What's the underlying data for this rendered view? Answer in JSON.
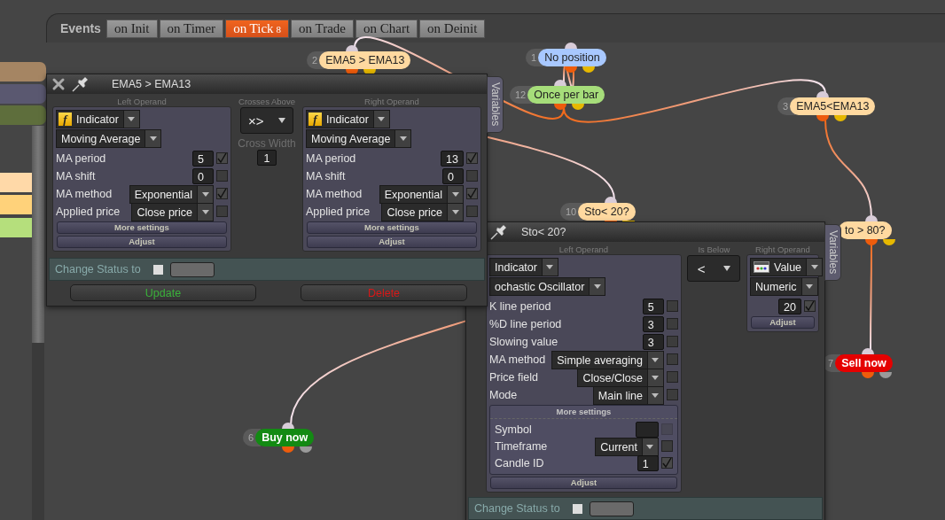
{
  "event_bar": {
    "label": "Events",
    "tabs": [
      {
        "label": "on Init",
        "selected": false
      },
      {
        "label": "on Timer",
        "selected": false
      },
      {
        "label": "on Tick",
        "badge": "8",
        "selected": true
      },
      {
        "label": "on Trade",
        "selected": false
      },
      {
        "label": "on Chart",
        "selected": false
      },
      {
        "label": "on Deinit",
        "selected": false
      }
    ]
  },
  "sidebar": {
    "items": [
      {
        "color": "#a58563"
      },
      {
        "color": "#5a5870"
      },
      {
        "color": "#5e6e3c"
      },
      {
        "color": "#ffd9a8"
      },
      {
        "color": "#ffd27a"
      },
      {
        "color": "#b5df7c"
      }
    ]
  },
  "nodes": [
    {
      "number": "2",
      "label": "EMA5 > EMA13",
      "kind": "condition",
      "color": "#ffd9a0"
    },
    {
      "number": "1",
      "label": "No position",
      "kind": "condition",
      "color": "#a8c8ff"
    },
    {
      "number": "12",
      "label": "Once per bar",
      "kind": "condition",
      "color": "#a6dd7a"
    },
    {
      "number": "3",
      "label": "EMA5<EMA13",
      "kind": "condition",
      "color": "#ffd9a0"
    },
    {
      "number": "10",
      "label": "Sto< 20?",
      "kind": "condition",
      "color": "#ffd9a0"
    },
    {
      "label": "to > 80?",
      "kind": "condition",
      "color": "#ffd9a0"
    },
    {
      "number": "7",
      "label": "Sell now",
      "kind": "action",
      "color": "#e50000"
    },
    {
      "number": "6",
      "label": "Buy now",
      "kind": "action",
      "color": "#138a13"
    }
  ],
  "windows": [
    {
      "title": "EMA5 > EMA13",
      "close_button": true,
      "variables_tab": "Variables",
      "left_header": "Left Operand",
      "operator_header": "Crosses Above",
      "right_header": "Right Operand",
      "left_operand": {
        "source": "Indicator",
        "kind": "indicator",
        "source_icon": "f",
        "function": "Moving Average",
        "params": [
          {
            "label": "MA period",
            "kind": "number",
            "value": "5",
            "checked": true
          },
          {
            "label": "MA shift",
            "kind": "number",
            "value": "0",
            "checked": false
          },
          {
            "label": "MA method",
            "kind": "select",
            "value": "Exponential",
            "checked": true
          },
          {
            "label": "Applied price",
            "kind": "select",
            "value": "Close price",
            "checked": false
          }
        ],
        "more_settings": {
          "label": "More settings",
          "expanded": false
        },
        "adjust": "Adjust"
      },
      "operator": {
        "symbol": "×>",
        "extra_label": "Cross Width",
        "extra_value": "1"
      },
      "right_operand": {
        "source": "Indicator",
        "kind": "indicator",
        "source_icon": "f",
        "function": "Moving Average",
        "params": [
          {
            "label": "MA period",
            "kind": "number",
            "value": "13",
            "checked": true
          },
          {
            "label": "MA shift",
            "kind": "number",
            "value": "0",
            "checked": false
          },
          {
            "label": "MA method",
            "kind": "select",
            "value": "Exponential",
            "checked": true
          },
          {
            "label": "Applied price",
            "kind": "select",
            "value": "Close price",
            "checked": false
          }
        ],
        "more_settings": {
          "label": "More settings",
          "expanded": false
        },
        "adjust": "Adjust"
      },
      "change_status": {
        "label": "Change Status to",
        "checked": false
      },
      "buttons": [
        {
          "label": "Update",
          "kind": "update"
        },
        {
          "label": "Delete",
          "kind": "delete"
        }
      ]
    },
    {
      "title": "Sto< 20?",
      "variables_tab": "Variables",
      "left_header": "Left Operand",
      "operator_header": "Is Below",
      "right_header": "Right Operand",
      "left_operand": {
        "source": "Indicator",
        "kind": "plain",
        "function": "ochastic Oscillator",
        "params": [
          {
            "label": "K line period",
            "kind": "number",
            "value": "5",
            "checked": false
          },
          {
            "label": "%D line period",
            "kind": "number",
            "value": "3",
            "checked": false
          },
          {
            "label": "Slowing value",
            "kind": "number",
            "value": "3",
            "checked": false
          },
          {
            "label": "MA method",
            "kind": "select",
            "value": "Simple averaging",
            "checked": false
          },
          {
            "label": "Price field",
            "kind": "select",
            "value": "Close/Close",
            "checked": false
          },
          {
            "label": "Mode",
            "kind": "select",
            "value": "Main line",
            "checked": false
          }
        ],
        "more_settings": {
          "label": "More settings",
          "expanded": true,
          "rows": [
            {
              "label": "Symbol",
              "kind": "field",
              "checked": false,
              "disabled": true
            },
            {
              "label": "Timeframe",
              "kind": "select",
              "value": "Current",
              "checked": false,
              "disabled": false
            },
            {
              "label": "Candle ID",
              "kind": "number",
              "value": "1",
              "checked": true,
              "disabled": false
            }
          ]
        },
        "adjust": "Adjust"
      },
      "operator": {
        "symbol": "<"
      },
      "right_operand": {
        "source": "Value",
        "kind": "value",
        "function": "Numeric",
        "params": [
          {
            "kind": "number",
            "value": "20",
            "checked": true
          }
        ],
        "adjust": "Adjust"
      },
      "change_status": {
        "label": "Change Status to",
        "checked": false
      }
    }
  ]
}
